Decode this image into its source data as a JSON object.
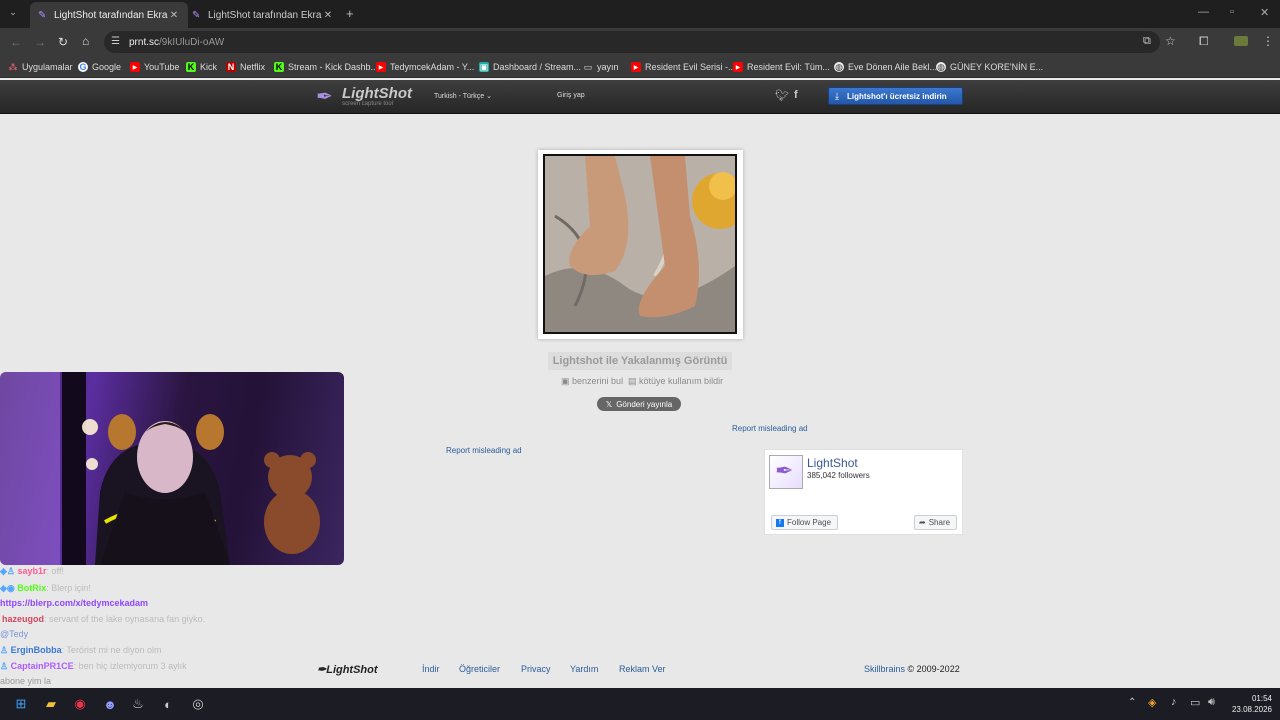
{
  "tabs": [
    {
      "title": "LightShot tarafından Ekran Görü",
      "active": true
    },
    {
      "title": "LightShot tarafından Ekran Görü",
      "active": false
    }
  ],
  "new_tab": "+",
  "url": {
    "host": "prnt.sc",
    "path": "/9kIUluDi-oAW"
  },
  "bookmarks": [
    {
      "label": "Uygulamalar",
      "icon": "apps-grid-icon"
    },
    {
      "label": "Google",
      "icon": "google-icon"
    },
    {
      "label": "YouTube",
      "icon": "youtube-icon"
    },
    {
      "label": "Kick",
      "icon": "kick-icon"
    },
    {
      "label": "Netflix",
      "icon": "netflix-icon"
    },
    {
      "label": "Stream - Kick Dashb...",
      "icon": "kick-icon"
    },
    {
      "label": "TedymcekAdam - Y...",
      "icon": "youtube-icon"
    },
    {
      "label": "Dashboard / Stream...",
      "icon": "stream-icon"
    },
    {
      "label": "yayın",
      "icon": "folder-icon"
    },
    {
      "label": "Resident Evil Serisi -...",
      "icon": "youtube-icon"
    },
    {
      "label": "Resident Evil: Tüm...",
      "icon": "youtube-icon"
    },
    {
      "label": "Eve Dönen Aile Bekl...",
      "icon": "globe-icon"
    },
    {
      "label": "GÜNEY KORE'NİN E...",
      "icon": "globe-icon"
    }
  ],
  "lightshot": {
    "logo": "LightShot",
    "tagline": "screen capture tool",
    "language": "Turkish - Türkçe",
    "login": "Giriş yap",
    "download_button": "Lightshot'ı ücretsiz indirin",
    "caption": "Lightshot ile Yakalanmış Görüntü",
    "find_similar": "benzerini bul",
    "report_abuse": "kötüye kullanım bildir",
    "post_button": "Gönderi yayınla",
    "report_ad_1": "Report misleading ad",
    "report_ad_2": "Report misleading ad",
    "fb_name": "LightShot",
    "fb_followers": "385,042 followers",
    "fb_follow": "Follow Page",
    "fb_share": "Share"
  },
  "footer": {
    "logo": "LightShot",
    "links": [
      "İndir",
      "Öğreticiler",
      "Privacy",
      "Yardım",
      "Reklam Ver"
    ],
    "brand": "Skillbrains",
    "copyright": "© 2009-2022"
  },
  "chat": [
    {
      "user": "sayb1r",
      "message": ": off!",
      "color": "#ff5c93"
    },
    {
      "user": "BotRix",
      "message": ": Blerp için!",
      "color": "#53fc18"
    },
    {
      "user": "",
      "message": "https://blerp.com/x/tedymcekadam",
      "color": "#9147ff"
    },
    {
      "user": "hazeugod",
      "message": ": servant of the lake oynasana fan giyko.",
      "color": "#ff4d6d"
    },
    {
      "user": "",
      "message": "@Tedy",
      "color": "#9ab6ff"
    },
    {
      "user": "ErginBobba",
      "message": ": Terörist mi ne diyon olm",
      "color": "#4a8cff"
    },
    {
      "user": "CaptainPR1CE",
      "message": ": ben hiç izlemiyorum 3 aylık",
      "color": "#b05cff"
    },
    {
      "user": "",
      "message": "abone yim la",
      "color": "#cccccc"
    }
  ],
  "clock": {
    "time": "01:54",
    "date": "23.08.2026"
  },
  "colors": {
    "accent": "#2a5d9a",
    "download_btn": "#2d63b8",
    "fb_blue": "#1877f2"
  }
}
